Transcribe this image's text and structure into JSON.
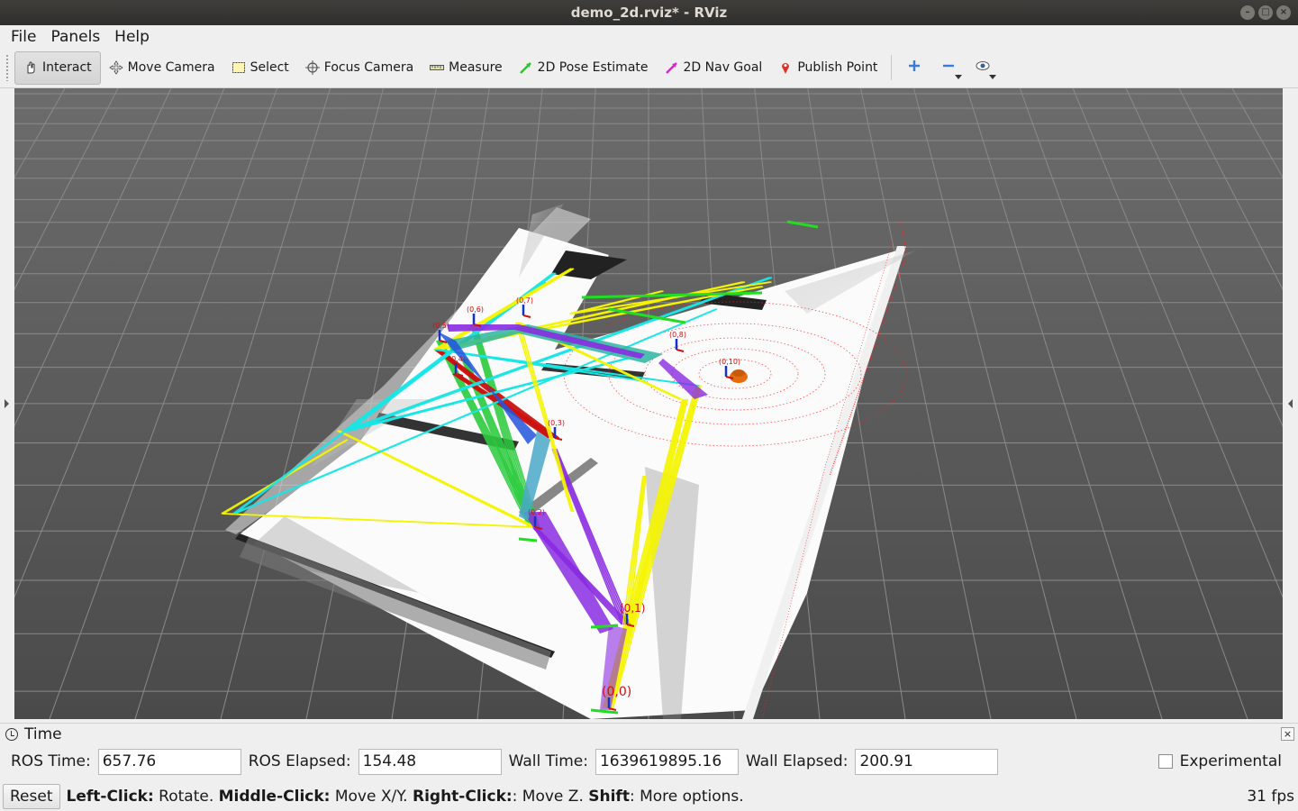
{
  "window": {
    "title": "demo_2d.rviz* - RViz",
    "buttons": [
      "minimize-icon",
      "maximize-icon",
      "close-icon"
    ]
  },
  "menu": [
    {
      "label": "File"
    },
    {
      "label": "Panels"
    },
    {
      "label": "Help"
    }
  ],
  "toolbar": {
    "tools": [
      {
        "label": "Interact",
        "icon": "hand-pointer-icon",
        "active": true
      },
      {
        "label": "Move Camera",
        "icon": "move-arrows-icon"
      },
      {
        "label": "Select",
        "icon": "select-rectangle-icon"
      },
      {
        "label": "Focus Camera",
        "icon": "crosshair-icon"
      },
      {
        "label": "Measure",
        "icon": "ruler-icon"
      },
      {
        "label": "2D Pose Estimate",
        "icon": "green-arrow-icon"
      },
      {
        "label": "2D Nav Goal",
        "icon": "magenta-arrow-icon"
      },
      {
        "label": "Publish Point",
        "icon": "map-pin-icon"
      }
    ],
    "extra": [
      "add-tool-icon",
      "remove-tool-icon",
      "camera-type-icon"
    ]
  },
  "scene": {
    "node_labels": [
      "(0,0)",
      "(0,1)",
      "(0,2)",
      "(0,3)",
      "(0,4)",
      "(0,5)",
      "(0,6)",
      "(0,7)",
      "(0,8)",
      "(0,10)"
    ],
    "colors": {
      "background": "#4d4d4d",
      "grid": "#8a8a8a",
      "map_free": "#ffffff",
      "edge_cyan": "#19e6e6",
      "edge_yellow": "#f5f500",
      "edge_purple": "#8a2be2",
      "edge_green": "#2ecc40",
      "edge_red": "#cc1111",
      "laser": "#ff2020",
      "robot": "#e66a10"
    }
  },
  "time_panel": {
    "title": "Time",
    "ros_time_label": "ROS Time:",
    "ros_time": "657.76",
    "ros_elapsed_label": "ROS Elapsed:",
    "ros_elapsed": "154.48",
    "wall_time_label": "Wall Time:",
    "wall_time": "1639619895.16",
    "wall_elapsed_label": "Wall Elapsed:",
    "wall_elapsed": "200.91",
    "experimental_label": "Experimental",
    "experimental_checked": false
  },
  "status": {
    "reset_label": "Reset",
    "hint_parts": [
      {
        "text": "Left-Click:",
        "bold": true
      },
      {
        "text": " Rotate. ",
        "bold": false
      },
      {
        "text": "Middle-Click:",
        "bold": true
      },
      {
        "text": " Move X/Y. ",
        "bold": false
      },
      {
        "text": "Right-Click:",
        "bold": true
      },
      {
        "text": ": Move Z. ",
        "bold": false
      },
      {
        "text": "Shift",
        "bold": true
      },
      {
        "text": ": More options.",
        "bold": false
      }
    ],
    "fps": "31 fps"
  }
}
